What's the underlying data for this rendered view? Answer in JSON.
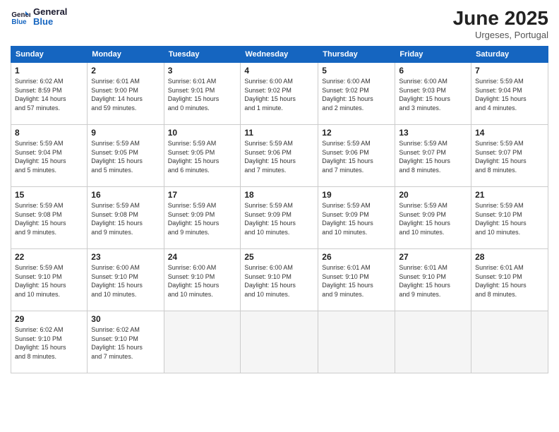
{
  "header": {
    "logo_general": "General",
    "logo_blue": "Blue",
    "month": "June 2025",
    "location": "Urgeses, Portugal"
  },
  "weekdays": [
    "Sunday",
    "Monday",
    "Tuesday",
    "Wednesday",
    "Thursday",
    "Friday",
    "Saturday"
  ],
  "weeks": [
    [
      {
        "day": "1",
        "info": "Sunrise: 6:02 AM\nSunset: 8:59 PM\nDaylight: 14 hours\nand 57 minutes."
      },
      {
        "day": "2",
        "info": "Sunrise: 6:01 AM\nSunset: 9:00 PM\nDaylight: 14 hours\nand 59 minutes."
      },
      {
        "day": "3",
        "info": "Sunrise: 6:01 AM\nSunset: 9:01 PM\nDaylight: 15 hours\nand 0 minutes."
      },
      {
        "day": "4",
        "info": "Sunrise: 6:00 AM\nSunset: 9:02 PM\nDaylight: 15 hours\nand 1 minute."
      },
      {
        "day": "5",
        "info": "Sunrise: 6:00 AM\nSunset: 9:02 PM\nDaylight: 15 hours\nand 2 minutes."
      },
      {
        "day": "6",
        "info": "Sunrise: 6:00 AM\nSunset: 9:03 PM\nDaylight: 15 hours\nand 3 minutes."
      },
      {
        "day": "7",
        "info": "Sunrise: 5:59 AM\nSunset: 9:04 PM\nDaylight: 15 hours\nand 4 minutes."
      }
    ],
    [
      {
        "day": "8",
        "info": "Sunrise: 5:59 AM\nSunset: 9:04 PM\nDaylight: 15 hours\nand 5 minutes."
      },
      {
        "day": "9",
        "info": "Sunrise: 5:59 AM\nSunset: 9:05 PM\nDaylight: 15 hours\nand 5 minutes."
      },
      {
        "day": "10",
        "info": "Sunrise: 5:59 AM\nSunset: 9:05 PM\nDaylight: 15 hours\nand 6 minutes."
      },
      {
        "day": "11",
        "info": "Sunrise: 5:59 AM\nSunset: 9:06 PM\nDaylight: 15 hours\nand 7 minutes."
      },
      {
        "day": "12",
        "info": "Sunrise: 5:59 AM\nSunset: 9:06 PM\nDaylight: 15 hours\nand 7 minutes."
      },
      {
        "day": "13",
        "info": "Sunrise: 5:59 AM\nSunset: 9:07 PM\nDaylight: 15 hours\nand 8 minutes."
      },
      {
        "day": "14",
        "info": "Sunrise: 5:59 AM\nSunset: 9:07 PM\nDaylight: 15 hours\nand 8 minutes."
      }
    ],
    [
      {
        "day": "15",
        "info": "Sunrise: 5:59 AM\nSunset: 9:08 PM\nDaylight: 15 hours\nand 9 minutes."
      },
      {
        "day": "16",
        "info": "Sunrise: 5:59 AM\nSunset: 9:08 PM\nDaylight: 15 hours\nand 9 minutes."
      },
      {
        "day": "17",
        "info": "Sunrise: 5:59 AM\nSunset: 9:09 PM\nDaylight: 15 hours\nand 9 minutes."
      },
      {
        "day": "18",
        "info": "Sunrise: 5:59 AM\nSunset: 9:09 PM\nDaylight: 15 hours\nand 10 minutes."
      },
      {
        "day": "19",
        "info": "Sunrise: 5:59 AM\nSunset: 9:09 PM\nDaylight: 15 hours\nand 10 minutes."
      },
      {
        "day": "20",
        "info": "Sunrise: 5:59 AM\nSunset: 9:09 PM\nDaylight: 15 hours\nand 10 minutes."
      },
      {
        "day": "21",
        "info": "Sunrise: 5:59 AM\nSunset: 9:10 PM\nDaylight: 15 hours\nand 10 minutes."
      }
    ],
    [
      {
        "day": "22",
        "info": "Sunrise: 5:59 AM\nSunset: 9:10 PM\nDaylight: 15 hours\nand 10 minutes."
      },
      {
        "day": "23",
        "info": "Sunrise: 6:00 AM\nSunset: 9:10 PM\nDaylight: 15 hours\nand 10 minutes."
      },
      {
        "day": "24",
        "info": "Sunrise: 6:00 AM\nSunset: 9:10 PM\nDaylight: 15 hours\nand 10 minutes."
      },
      {
        "day": "25",
        "info": "Sunrise: 6:00 AM\nSunset: 9:10 PM\nDaylight: 15 hours\nand 10 minutes."
      },
      {
        "day": "26",
        "info": "Sunrise: 6:01 AM\nSunset: 9:10 PM\nDaylight: 15 hours\nand 9 minutes."
      },
      {
        "day": "27",
        "info": "Sunrise: 6:01 AM\nSunset: 9:10 PM\nDaylight: 15 hours\nand 9 minutes."
      },
      {
        "day": "28",
        "info": "Sunrise: 6:01 AM\nSunset: 9:10 PM\nDaylight: 15 hours\nand 8 minutes."
      }
    ],
    [
      {
        "day": "29",
        "info": "Sunrise: 6:02 AM\nSunset: 9:10 PM\nDaylight: 15 hours\nand 8 minutes."
      },
      {
        "day": "30",
        "info": "Sunrise: 6:02 AM\nSunset: 9:10 PM\nDaylight: 15 hours\nand 7 minutes."
      },
      {
        "day": "",
        "info": ""
      },
      {
        "day": "",
        "info": ""
      },
      {
        "day": "",
        "info": ""
      },
      {
        "day": "",
        "info": ""
      },
      {
        "day": "",
        "info": ""
      }
    ]
  ]
}
